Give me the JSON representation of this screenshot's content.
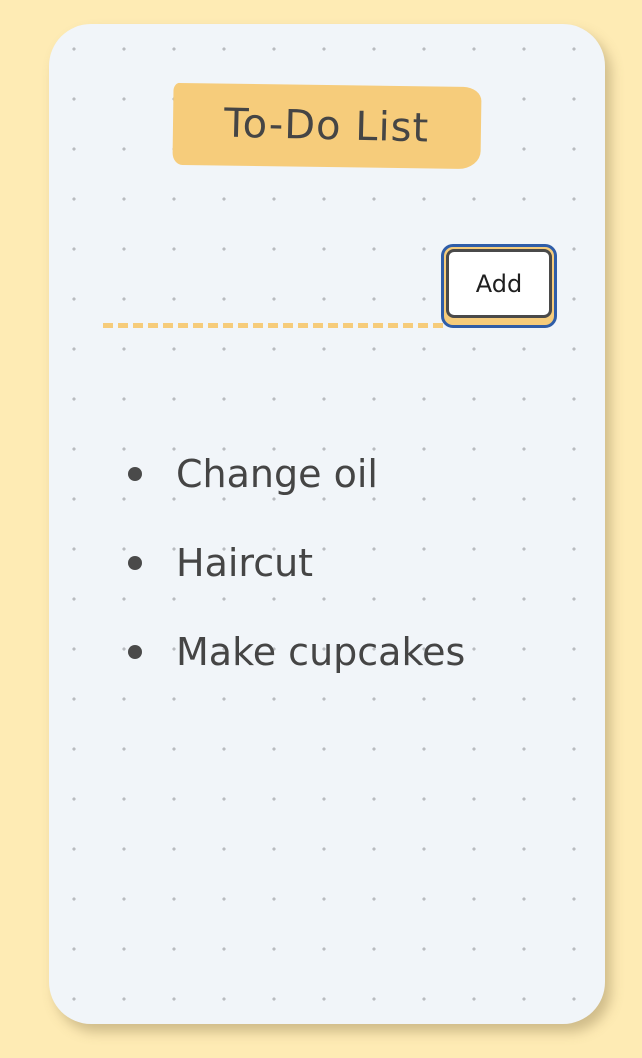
{
  "app": {
    "title": "To-Do List"
  },
  "input": {
    "value": "",
    "placeholder": ""
  },
  "add_button": {
    "label": "Add"
  },
  "todos": [
    {
      "text": "Change oil"
    },
    {
      "text": "Haircut"
    },
    {
      "text": "Make cupcakes"
    }
  ],
  "colors": {
    "page_background": "#feebb4",
    "card_background": "#f1f5f9",
    "accent_yellow": "#f6cc7b",
    "button_border": "#2f5da8",
    "text": "#454545"
  }
}
